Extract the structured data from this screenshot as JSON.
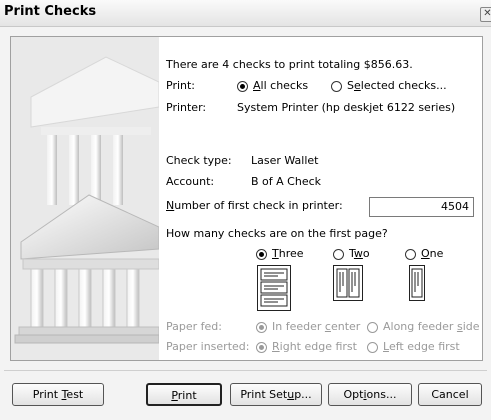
{
  "window": {
    "title": "Print Checks",
    "close_glyph": "✕"
  },
  "summary": "There are 4 checks to print totaling $856.63.",
  "print": {
    "label": "Print:",
    "options": [
      {
        "pre": "",
        "acc": "A",
        "post": "ll checks",
        "selected": true
      },
      {
        "pre": "S",
        "acc": "e",
        "post": "lected checks...",
        "selected": false
      }
    ]
  },
  "printer": {
    "label": "Printer:",
    "value": "System Printer (hp deskjet 6122 series)"
  },
  "check_type": {
    "label": "Check type:",
    "value": "Laser Wallet"
  },
  "account": {
    "label": "Account:",
    "value": "B of A Check"
  },
  "first_check": {
    "label_acc": "N",
    "label_rest": "umber of first check in printer:",
    "value": "4504"
  },
  "first_page": {
    "question": "How many checks are on the first page?",
    "options": [
      {
        "pre": "",
        "acc": "T",
        "post": "hree",
        "selected": true
      },
      {
        "pre": "T",
        "acc": "w",
        "post": "o",
        "selected": false
      },
      {
        "pre": "",
        "acc": "O",
        "post": "ne",
        "selected": false
      }
    ]
  },
  "paper_fed": {
    "label": "Paper fed:",
    "options": [
      {
        "pre": "In feeder ",
        "acc": "c",
        "post": "enter",
        "selected": true
      },
      {
        "pre": "Along feeder ",
        "acc": "s",
        "post": "ide",
        "selected": false
      }
    ]
  },
  "paper_inserted": {
    "label": "Paper inserted:",
    "options": [
      {
        "pre": "",
        "acc": "R",
        "post": "ight edge first",
        "selected": true
      },
      {
        "pre": "",
        "acc": "L",
        "post": "eft edge first",
        "selected": false
      }
    ]
  },
  "buttons": {
    "print_test": {
      "pre": "Print ",
      "acc": "T",
      "post": "est"
    },
    "print": {
      "pre": "",
      "acc": "P",
      "post": "rint"
    },
    "print_setup": {
      "pre": "Print Set",
      "acc": "u",
      "post": "p..."
    },
    "options": {
      "pre": "Opt",
      "acc": "i",
      "post": "ons..."
    },
    "cancel": {
      "label": "Cancel"
    }
  }
}
